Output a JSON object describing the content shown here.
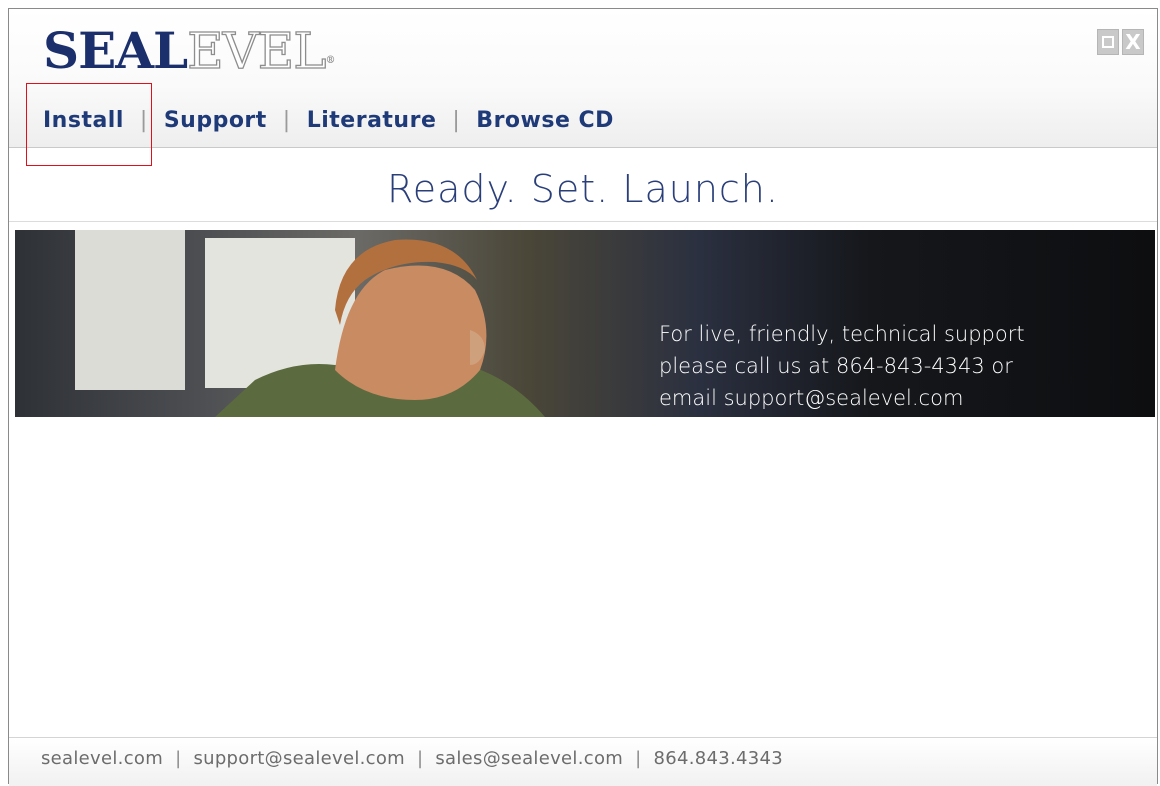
{
  "header": {
    "logo_part1": "SEAL",
    "logo_part2": "EVEL",
    "logo_mark": "®"
  },
  "window_controls": {
    "maximize_icon": "maximize-icon",
    "close_icon": "close-icon",
    "close_glyph": "X"
  },
  "nav": {
    "items": [
      {
        "label": "Install"
      },
      {
        "label": "Support"
      },
      {
        "label": "Literature"
      },
      {
        "label": "Browse CD"
      }
    ],
    "separator": "|"
  },
  "tagline": "Ready. Set. Launch.",
  "banner": {
    "lines": [
      "For live, friendly, technical support",
      "please call us at 864-843-4343 or",
      "email support@sealevel.com"
    ]
  },
  "footer": {
    "links": [
      {
        "label": "sealevel.com"
      },
      {
        "label": "support@sealevel.com"
      },
      {
        "label": "sales@sealevel.com"
      },
      {
        "label": "864.843.4343"
      }
    ],
    "separator": "|"
  },
  "colors": {
    "brand_navy": "#1a2f6b",
    "nav_text": "#1f3a78",
    "highlight_box": "#e0101a"
  }
}
